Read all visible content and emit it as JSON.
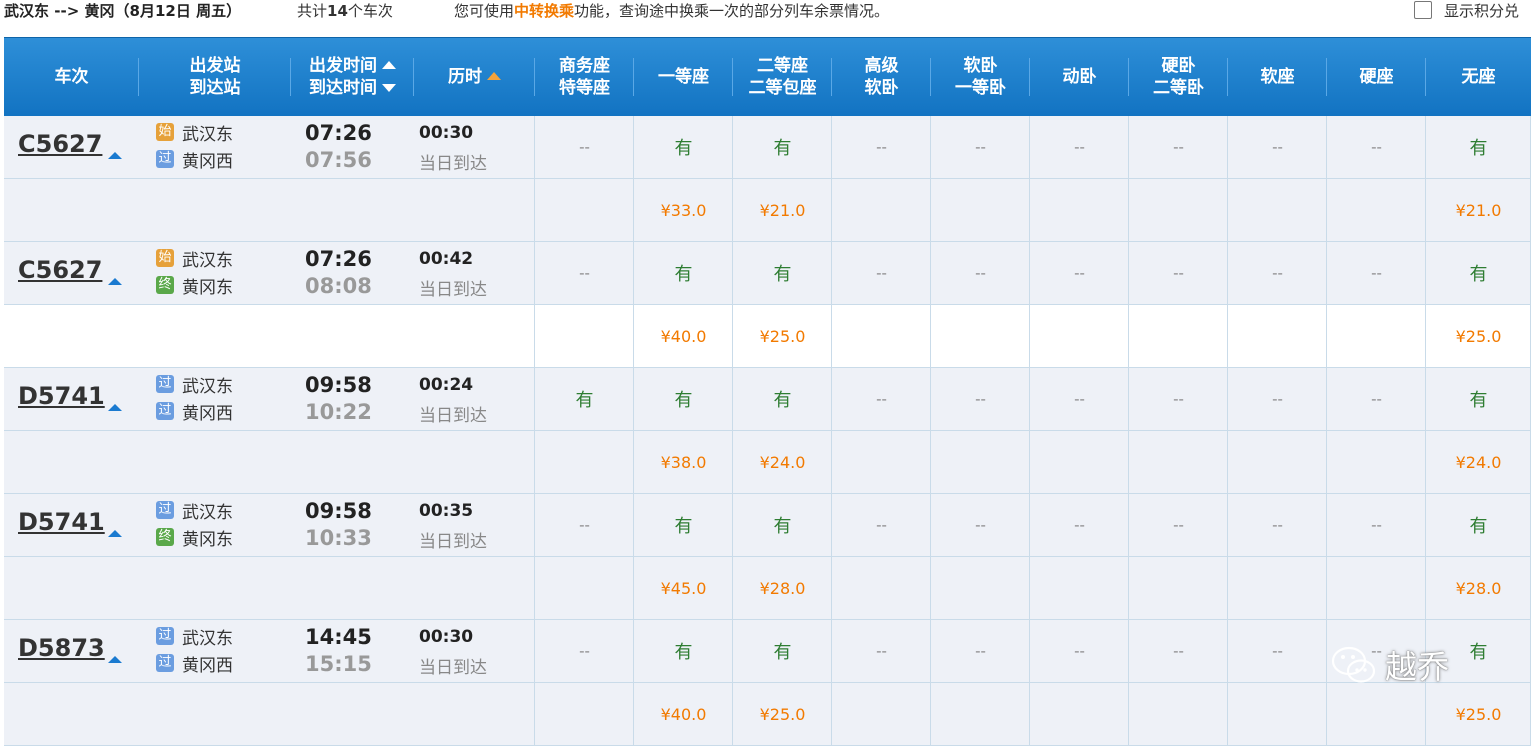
{
  "topbar": {
    "route_from": "武汉东",
    "route_arrow": "-->",
    "route_to": "黄冈",
    "date_open": "（",
    "date_num": "8",
    "date_month": "月",
    "date_day": "12",
    "date_rest": "日  周五）",
    "count_prefix": "共计",
    "count_num": "14",
    "count_suffix": "个车次",
    "hint_prefix": "您可使用",
    "hint_highlight": "中转换乘",
    "hint_suffix": "功能，查询途中换乘一次的部分列车余票情况。",
    "show_points_label": "显示积分兑"
  },
  "columns": [
    {
      "l1": "车次",
      "l2": ""
    },
    {
      "l1": "出发站",
      "l2": "到达站"
    },
    {
      "l1": "出发时间",
      "l2": "到达时间"
    },
    {
      "l1": "历时",
      "l2": ""
    },
    {
      "l1": "商务座",
      "l2": "特等座"
    },
    {
      "l1": "一等座",
      "l2": ""
    },
    {
      "l1": "二等座",
      "l2": "二等包座"
    },
    {
      "l1": "高级",
      "l2": "软卧"
    },
    {
      "l1": "软卧",
      "l2": "一等卧"
    },
    {
      "l1": "动卧",
      "l2": ""
    },
    {
      "l1": "硬卧",
      "l2": "二等卧"
    },
    {
      "l1": "软座",
      "l2": ""
    },
    {
      "l1": "硬座",
      "l2": ""
    },
    {
      "l1": "无座",
      "l2": ""
    }
  ],
  "badges": {
    "start": "始",
    "pass": "过",
    "end": "终"
  },
  "trains": [
    {
      "no": "C5627",
      "from_badge": "始",
      "from": "武汉东",
      "to_badge": "过",
      "to": "黄冈西",
      "dep": "07:26",
      "arr": "07:56",
      "dur": "00:30",
      "arrive_note": "当日到达",
      "seats": [
        "--",
        "有",
        "有",
        "--",
        "--",
        "--",
        "--",
        "--",
        "--",
        "有"
      ],
      "prices": [
        "",
        "¥33.0",
        "¥21.0",
        "",
        "",
        "",
        "",
        "",
        "",
        "¥21.0"
      ]
    },
    {
      "no": "C5627",
      "from_badge": "始",
      "from": "武汉东",
      "to_badge": "终",
      "to": "黄冈东",
      "dep": "07:26",
      "arr": "08:08",
      "dur": "00:42",
      "arrive_note": "当日到达",
      "seats": [
        "--",
        "有",
        "有",
        "--",
        "--",
        "--",
        "--",
        "--",
        "--",
        "有"
      ],
      "prices": [
        "",
        "¥40.0",
        "¥25.0",
        "",
        "",
        "",
        "",
        "",
        "",
        "¥25.0"
      ]
    },
    {
      "no": "D5741",
      "from_badge": "过",
      "from": "武汉东",
      "to_badge": "过",
      "to": "黄冈西",
      "dep": "09:58",
      "arr": "10:22",
      "dur": "00:24",
      "arrive_note": "当日到达",
      "seats": [
        "有",
        "有",
        "有",
        "--",
        "--",
        "--",
        "--",
        "--",
        "--",
        "有"
      ],
      "prices": [
        "",
        "¥38.0",
        "¥24.0",
        "",
        "",
        "",
        "",
        "",
        "",
        "¥24.0"
      ]
    },
    {
      "no": "D5741",
      "from_badge": "过",
      "from": "武汉东",
      "to_badge": "终",
      "to": "黄冈东",
      "dep": "09:58",
      "arr": "10:33",
      "dur": "00:35",
      "arrive_note": "当日到达",
      "seats": [
        "--",
        "有",
        "有",
        "--",
        "--",
        "--",
        "--",
        "--",
        "--",
        "有"
      ],
      "prices": [
        "",
        "¥45.0",
        "¥28.0",
        "",
        "",
        "",
        "",
        "",
        "",
        "¥28.0"
      ]
    },
    {
      "no": "D5873",
      "from_badge": "过",
      "from": "武汉东",
      "to_badge": "过",
      "to": "黄冈西",
      "dep": "14:45",
      "arr": "15:15",
      "dur": "00:30",
      "arrive_note": "当日到达",
      "seats": [
        "--",
        "有",
        "有",
        "--",
        "--",
        "--",
        "--",
        "--",
        "--",
        "有"
      ],
      "prices": [
        "",
        "¥40.0",
        "¥25.0",
        "",
        "",
        "",
        "",
        "",
        "",
        "¥25.0"
      ]
    }
  ],
  "watermark": {
    "text": "越乔"
  }
}
